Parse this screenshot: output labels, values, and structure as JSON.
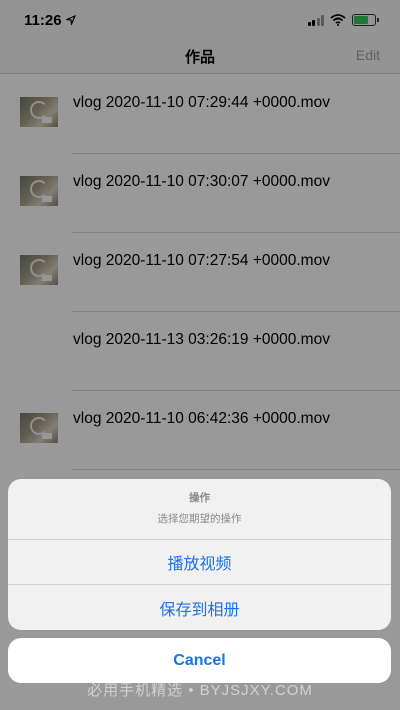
{
  "status_bar": {
    "time": "11:26",
    "location_icon": "location-arrow-icon",
    "battery_color": "#34c759"
  },
  "nav": {
    "title": "作品",
    "edit_label": "Edit"
  },
  "videos": [
    {
      "name": "vlog 2020-11-10 07:29:44 +0000.mov",
      "has_thumbnail": true
    },
    {
      "name": "vlog 2020-11-10 07:30:07 +0000.mov",
      "has_thumbnail": true
    },
    {
      "name": "vlog 2020-11-10 07:27:54 +0000.mov",
      "has_thumbnail": true
    },
    {
      "name": "vlog 2020-11-13 03:26:19 +0000.mov",
      "has_thumbnail": false
    },
    {
      "name": "vlog 2020-11-10 06:42:36 +0000.mov",
      "has_thumbnail": true
    }
  ],
  "action_sheet": {
    "title": "操作",
    "message": "选择您期望的操作",
    "actions": [
      "播放视频",
      "保存到相册"
    ],
    "cancel_label": "Cancel",
    "accent_color": "#1a73e8"
  },
  "watermark": "必用手机精选 • BYJSJXY.COM"
}
